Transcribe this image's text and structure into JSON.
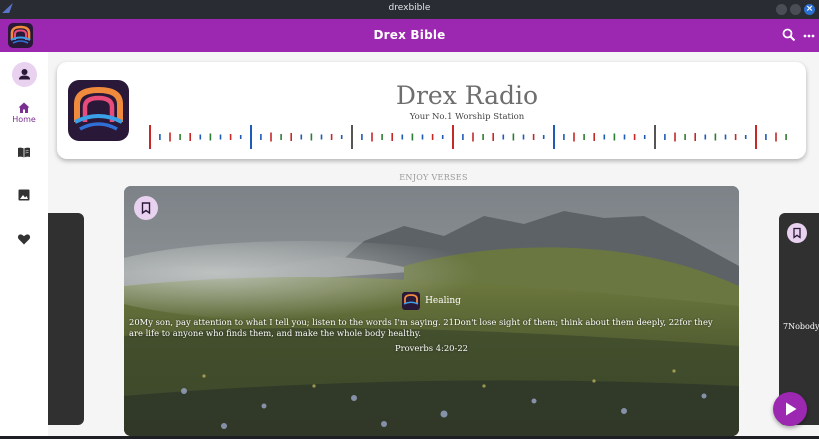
{
  "window": {
    "title": "drexbible"
  },
  "appbar": {
    "title": "Drex Bible",
    "search_icon": "search-icon",
    "more_icon": "more-vert-icon"
  },
  "nav": {
    "items": [
      {
        "name": "account",
        "icon": "person-icon",
        "label": ""
      },
      {
        "name": "home",
        "icon": "home-icon",
        "label": "Home",
        "selected": true
      },
      {
        "name": "bible",
        "icon": "book-icon",
        "label": ""
      },
      {
        "name": "images",
        "icon": "image-icon",
        "label": ""
      },
      {
        "name": "favorites",
        "icon": "heart-icon",
        "label": ""
      }
    ]
  },
  "radio": {
    "title": "Drex Radio",
    "subtitle": "Your No.1 Worship Station",
    "wave_colors": [
      "#c62828",
      "#1e5bb8",
      "#2e7d32",
      "#555555"
    ]
  },
  "verses": {
    "section_label": "ENJOY VERSES",
    "current": {
      "tag": "Healing",
      "text": "20My son, pay attention to what I tell you; listen to the words I'm saying. 21Don't lose sight of them; think about them deeply, 22for they are life to anyone who finds them, and make the whole body healthy.",
      "reference": "Proverbs 4:20-22"
    },
    "next_snippet": "7Nobody"
  },
  "colors": {
    "primary": "#9c27b0",
    "accent_light": "#e9d2f0",
    "logo_bg": "#2a1838"
  }
}
